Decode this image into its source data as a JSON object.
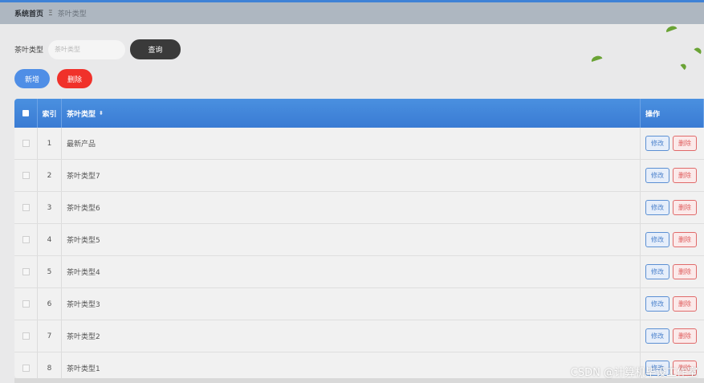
{
  "breadcrumb": {
    "home": "系统首页",
    "separator": "Ξ",
    "current": "茶叶类型"
  },
  "search": {
    "label": "茶叶类型",
    "placeholder": "茶叶类型",
    "button": "查询"
  },
  "actions": {
    "add": "新增",
    "delete": "删除"
  },
  "table": {
    "headers": {
      "index": "索引",
      "type": "茶叶类型",
      "ops": "操作"
    },
    "rows": [
      {
        "index": "1",
        "type": "最新产品",
        "edit": "修改",
        "delete": "删除"
      },
      {
        "index": "2",
        "type": "茶叶类型7",
        "edit": "修改",
        "delete": "删除"
      },
      {
        "index": "3",
        "type": "茶叶类型6",
        "edit": "修改",
        "delete": "删除"
      },
      {
        "index": "4",
        "type": "茶叶类型5",
        "edit": "修改",
        "delete": "删除"
      },
      {
        "index": "5",
        "type": "茶叶类型4",
        "edit": "修改",
        "delete": "删除"
      },
      {
        "index": "6",
        "type": "茶叶类型3",
        "edit": "修改",
        "delete": "删除"
      },
      {
        "index": "7",
        "type": "茶叶类型2",
        "edit": "修改",
        "delete": "删除"
      },
      {
        "index": "8",
        "type": "茶叶类型1",
        "edit": "修改",
        "delete": "删除"
      }
    ]
  },
  "icons": {
    "sort": "sort-icon",
    "leaf": "leaf-icon"
  },
  "watermark": "CSDN @计算机毕设工作室",
  "colors": {
    "header_blue": "#4a90e0",
    "add_blue": "#4f8ee6",
    "delete_red": "#f0312a",
    "query_dark": "#3a3a3a"
  }
}
